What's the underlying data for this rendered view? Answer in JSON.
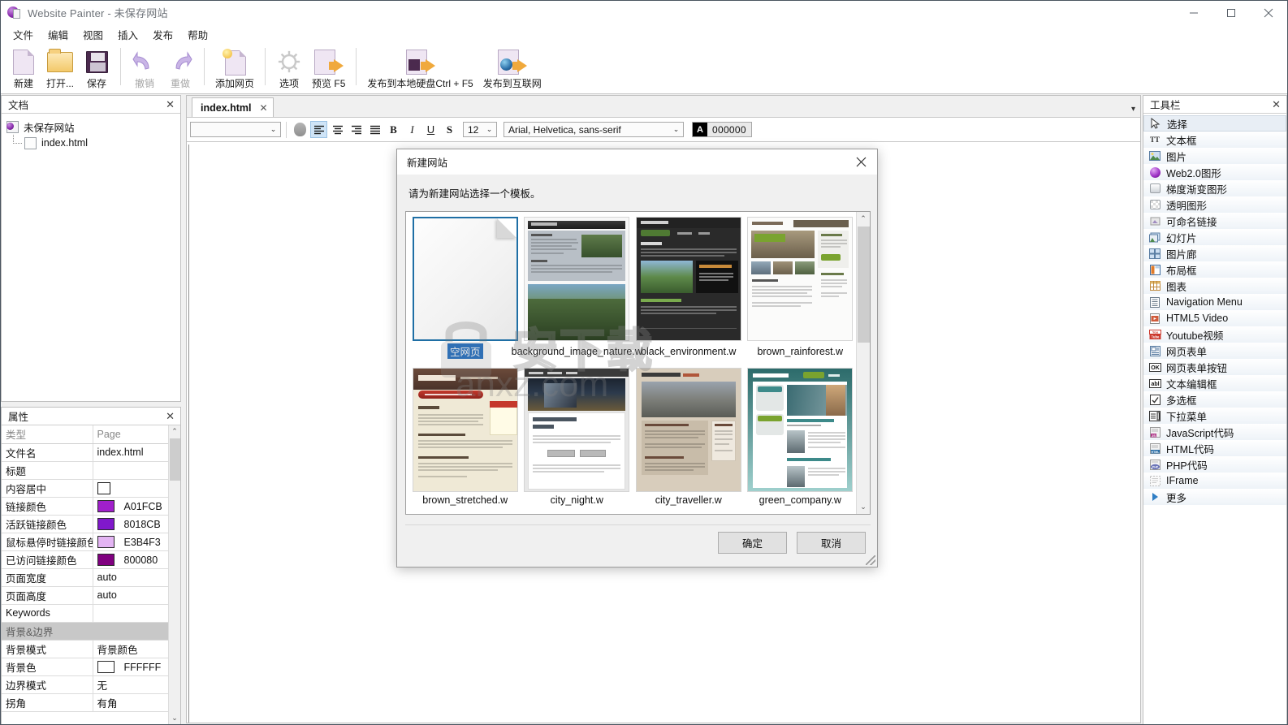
{
  "window": {
    "title": "Website Painter - 未保存网站",
    "icon": "app-globe-page-icon",
    "minimize": "–",
    "maximize": "□",
    "close": "✕"
  },
  "menubar": {
    "items": [
      {
        "label": "文件"
      },
      {
        "label": "编辑"
      },
      {
        "label": "视图"
      },
      {
        "label": "插入"
      },
      {
        "label": "发布"
      },
      {
        "label": "帮助"
      }
    ]
  },
  "ribbon": {
    "buttons": [
      {
        "label": "新建",
        "icon": "new-page-icon",
        "disabled": false
      },
      {
        "label": "打开...",
        "icon": "open-folder-icon",
        "disabled": false
      },
      {
        "label": "保存",
        "icon": "save-floppy-icon",
        "disabled": false
      },
      {
        "label": "撤销",
        "icon": "undo-arrow-icon",
        "disabled": true
      },
      {
        "label": "重做",
        "icon": "redo-arrow-icon",
        "disabled": true
      },
      {
        "label": "添加网页",
        "icon": "add-page-icon",
        "disabled": false
      },
      {
        "label": "选项",
        "icon": "gear-icon",
        "disabled": false
      },
      {
        "label": "预览 F5",
        "icon": "preview-page-icon",
        "disabled": false
      },
      {
        "label": "发布到本地硬盘Ctrl + F5",
        "icon": "publish-local-icon",
        "disabled": false
      },
      {
        "label": "发布到互联网",
        "icon": "publish-web-icon",
        "disabled": false
      }
    ]
  },
  "documents_panel": {
    "title": "文档",
    "close": "✕",
    "tree": {
      "root": "未保存网站",
      "root_icon": "site-icon",
      "child": "index.html",
      "child_icon": "html-file-icon"
    }
  },
  "properties_panel": {
    "title": "属性",
    "close": "✕",
    "header": {
      "key": "类型",
      "value": "Page"
    },
    "rows": [
      {
        "key": "文件名",
        "value": "index.html",
        "type": "text"
      },
      {
        "key": "标题",
        "value": "",
        "type": "text"
      },
      {
        "key": "内容居中",
        "value": "",
        "type": "checkbox",
        "checked": false
      },
      {
        "key": "链接颜色",
        "value": "A01FCB",
        "type": "color",
        "color": "#A01FCB"
      },
      {
        "key": "活跃链接颜色",
        "value": "8018CB",
        "type": "color",
        "color": "#8018CB"
      },
      {
        "key": "鼠标悬停时链接颜色",
        "value": "E3B4F3",
        "type": "color",
        "color": "#E3B4F3"
      },
      {
        "key": "已访问链接颜色",
        "value": "800080",
        "type": "color",
        "color": "#800080"
      },
      {
        "key": "页面宽度",
        "value": "auto",
        "type": "text"
      },
      {
        "key": "页面高度",
        "value": "auto",
        "type": "text"
      },
      {
        "key": "Keywords",
        "value": "",
        "type": "text"
      },
      {
        "key": "背景&边界",
        "value": "",
        "type": "group"
      },
      {
        "key": "背景模式",
        "value": "背景颜色",
        "type": "text"
      },
      {
        "key": "背景色",
        "value": "FFFFFF",
        "type": "color",
        "color": "#FFFFFF"
      },
      {
        "key": "边界模式",
        "value": "无",
        "type": "text"
      },
      {
        "key": "拐角",
        "value": "有角",
        "type": "text"
      }
    ],
    "scroll": {
      "up": "⌃",
      "down": "⌄"
    }
  },
  "toolbox_panel": {
    "title": "工具栏",
    "close": "✕",
    "items": [
      {
        "label": "选择",
        "icon": "cursor-arrow-icon",
        "selected": true
      },
      {
        "label": "文本框",
        "icon": "text-box-icon",
        "selected": false
      },
      {
        "label": "图片",
        "icon": "image-icon",
        "selected": false
      },
      {
        "label": "Web2.0图形",
        "icon": "web20-shape-icon",
        "selected": false
      },
      {
        "label": "梯度渐变图形",
        "icon": "gradient-shape-icon",
        "selected": false
      },
      {
        "label": "透明图形",
        "icon": "transparent-shape-icon",
        "selected": false
      },
      {
        "label": "可命名链接",
        "icon": "anchor-link-icon",
        "selected": false
      },
      {
        "label": "幻灯片",
        "icon": "slideshow-icon",
        "selected": false
      },
      {
        "label": "图片廊",
        "icon": "gallery-icon",
        "selected": false
      },
      {
        "label": "布局框",
        "icon": "layout-box-icon",
        "selected": false
      },
      {
        "label": "图表",
        "icon": "table-icon",
        "selected": false
      },
      {
        "label": "Navigation Menu",
        "icon": "navigation-menu-icon",
        "selected": false
      },
      {
        "label": "HTML5 Video",
        "icon": "html5-video-icon",
        "selected": false
      },
      {
        "label": "Youtube视频",
        "icon": "youtube-icon",
        "selected": false
      },
      {
        "label": "网页表单",
        "icon": "web-form-icon",
        "selected": false
      },
      {
        "label": "网页表单按钮",
        "icon": "form-button-icon",
        "selected": false
      },
      {
        "label": "文本编辑框",
        "icon": "text-input-icon",
        "selected": false
      },
      {
        "label": "多选框",
        "icon": "checkbox-icon",
        "selected": false
      },
      {
        "label": "下拉菜单",
        "icon": "dropdown-icon",
        "selected": false
      },
      {
        "label": "JavaScript代码",
        "icon": "javascript-code-icon",
        "selected": false
      },
      {
        "label": "HTML代码",
        "icon": "html-code-icon",
        "selected": false
      },
      {
        "label": "PHP代码",
        "icon": "php-code-icon",
        "selected": false
      },
      {
        "label": "IFrame",
        "icon": "iframe-icon",
        "selected": false
      },
      {
        "label": "更多",
        "icon": "more-triangle-icon",
        "selected": false
      }
    ]
  },
  "editor": {
    "tab": {
      "label": "index.html",
      "close": "✕"
    },
    "tab_overflow": "▾",
    "format_bar": {
      "style_value": "",
      "style_placeholder": "",
      "shape_icon": "shape-blob-icon",
      "align_left": "align-left-icon",
      "align_center": "align-center-icon",
      "align_right": "align-right-icon",
      "align_justify": "align-justify-icon",
      "bold": "B",
      "italic": "I",
      "underline": "U",
      "strike": "S",
      "font_size": "12",
      "font_family": "Arial, Helvetica, sans-serif",
      "text_color_label": "A",
      "text_color_hex": "000000"
    }
  },
  "dialog": {
    "title": "新建网站",
    "close": "✕",
    "prompt": "请为新建网站选择一个模板。",
    "ok": "确定",
    "cancel": "取消",
    "scroll": {
      "up": "⌃",
      "down": "⌄"
    },
    "templates": [
      {
        "name": "空网页",
        "selected": true,
        "style": "blank"
      },
      {
        "name": "background_image_nature.w",
        "selected": false,
        "style": "portfolio"
      },
      {
        "name": "black_environment.w",
        "selected": false,
        "style": "black"
      },
      {
        "name": "brown_rainforest.w",
        "selected": false,
        "style": "rainforest"
      },
      {
        "name": "brown_stretched.w",
        "selected": false,
        "style": "brown"
      },
      {
        "name": "city_night.w",
        "selected": false,
        "style": "citynight"
      },
      {
        "name": "city_traveller.w",
        "selected": false,
        "style": "traveller"
      },
      {
        "name": "green_company.w",
        "selected": false,
        "style": "greencompany"
      }
    ]
  },
  "watermark": {
    "text": "安下载",
    "subtext": "anxz.com",
    "icon": "lock-watermark-icon"
  }
}
